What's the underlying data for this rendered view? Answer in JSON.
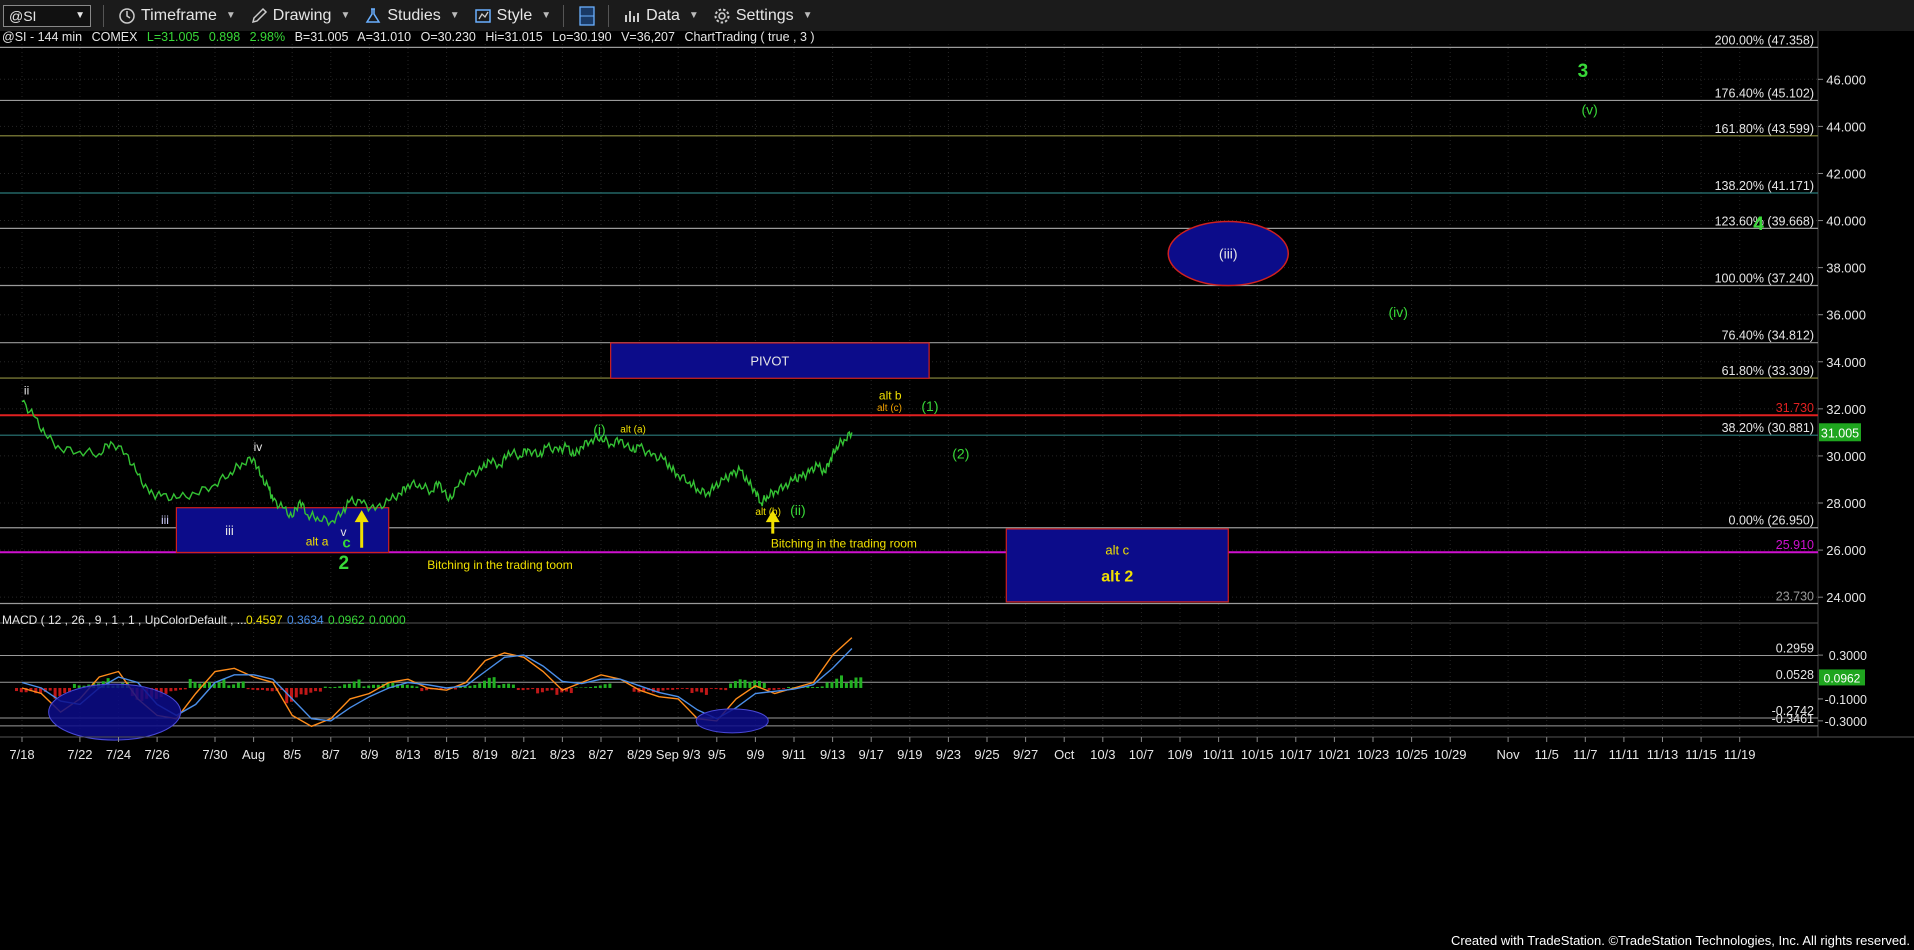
{
  "toolbar": {
    "symbol": "@SI",
    "timeframe": "Timeframe",
    "drawing": "Drawing",
    "studies": "Studies",
    "style": "Style",
    "data": "Data",
    "settings": "Settings"
  },
  "header_line": {
    "symbol": "@SI - 144 min",
    "exchange": "COMEX",
    "last": "L=31.005",
    "change": "0.898",
    "pct": "2.98%",
    "bid": "B=31.005",
    "ask": "A=31.010",
    "open": "O=30.230",
    "high": "Hi=31.015",
    "low": "Lo=30.190",
    "volume": "V=36,207",
    "study": "ChartTrading ( true , 3 )"
  },
  "footer": "Created with TradeStation. ©TradeStation Technologies, Inc. All rights reserved.",
  "colors": {
    "price": "#34c234",
    "fib_line": "#9a9a9a",
    "red_line": "#e02020",
    "magenta_line": "#d010d0",
    "box_fill": "#0c0c8a",
    "box_border": "#d02020",
    "label_yellow": "#f0e000",
    "label_green": "#38d838",
    "macd_blue": "#4a8ee8",
    "macd_orange": "#ff8c1a",
    "hist_green": "#22b022",
    "hist_red": "#c01818"
  },
  "chart_data": {
    "type": "line",
    "title": "@SI - 144 min",
    "xlabel": "",
    "ylabel": "",
    "ylim": [
      23.2,
      47.5
    ],
    "x_ticks": [
      "7/18",
      "7/22",
      "7/24",
      "7/26",
      "7/30",
      "Aug",
      "8/5",
      "8/7",
      "8/9",
      "8/13",
      "8/15",
      "8/19",
      "8/21",
      "8/23",
      "8/27",
      "8/29",
      "Sep 9/3",
      "9/5",
      "9/9",
      "9/11",
      "9/13",
      "9/17",
      "9/19",
      "9/23",
      "9/25",
      "9/27",
      "Oct",
      "10/3",
      "10/7",
      "10/9",
      "10/11",
      "10/15",
      "10/17",
      "10/21",
      "10/23",
      "10/25",
      "10/29",
      "Nov",
      "11/5",
      "11/7",
      "11/11",
      "11/13",
      "11/15",
      "11/19"
    ],
    "x_tick_index": [
      0,
      3,
      5,
      7,
      10,
      12,
      14,
      16,
      18,
      20,
      22,
      24,
      26,
      28,
      30,
      32,
      34,
      36,
      38,
      40,
      42,
      44,
      46,
      48,
      50,
      52,
      54,
      56,
      58,
      60,
      62,
      64,
      66,
      68,
      70,
      72,
      74,
      77,
      79,
      81,
      83,
      85,
      87,
      89
    ],
    "y_ticks": [
      24.0,
      26.0,
      28.0,
      30.0,
      32.0,
      34.0,
      36.0,
      38.0,
      40.0,
      42.0,
      44.0,
      46.0
    ],
    "series": [
      {
        "values": [
          [
            0,
            32.3
          ],
          [
            0.6,
            31.7
          ],
          [
            1.2,
            30.9
          ],
          [
            2,
            30.3
          ],
          [
            3,
            30.2
          ],
          [
            4,
            30.1
          ],
          [
            4.6,
            30.6
          ],
          [
            5.4,
            30.1
          ],
          [
            6,
            29.2
          ],
          [
            6.6,
            28.4
          ],
          [
            7.2,
            28.3
          ],
          [
            8,
            28.2
          ],
          [
            9,
            28.4
          ],
          [
            10,
            28.8
          ],
          [
            10.8,
            29.3
          ],
          [
            11.4,
            29.7
          ],
          [
            12,
            29.9
          ],
          [
            12.4,
            29.1
          ],
          [
            12.8,
            28.6
          ],
          [
            13,
            28.1
          ],
          [
            13.5,
            27.8
          ],
          [
            14,
            27.4
          ],
          [
            14.4,
            28.1
          ],
          [
            14.8,
            27.5
          ],
          [
            15.3,
            27.4
          ],
          [
            16,
            27.2
          ],
          [
            16.6,
            27.6
          ],
          [
            17,
            28.1
          ],
          [
            17.6,
            28.0
          ],
          [
            18.3,
            27.7
          ],
          [
            19,
            28.1
          ],
          [
            19.6,
            28.4
          ],
          [
            20,
            28.8
          ],
          [
            20.6,
            28.8
          ],
          [
            21.2,
            28.5
          ],
          [
            21.6,
            28.9
          ],
          [
            22.1,
            28.1
          ],
          [
            22.6,
            28.7
          ],
          [
            23.2,
            29.2
          ],
          [
            23.8,
            29.4
          ],
          [
            24.2,
            29.8
          ],
          [
            24.8,
            29.6
          ],
          [
            25.2,
            30.2
          ],
          [
            25.8,
            30.0
          ],
          [
            26.2,
            30.3
          ],
          [
            26.8,
            30.0
          ],
          [
            27.2,
            30.4
          ],
          [
            27.8,
            30.2
          ],
          [
            28.2,
            30.4
          ],
          [
            28.6,
            30.0
          ],
          [
            29,
            30.4
          ],
          [
            29.5,
            30.7
          ],
          [
            30,
            30.8
          ],
          [
            30.5,
            30.5
          ],
          [
            31,
            30.7
          ],
          [
            31.6,
            30.2
          ],
          [
            32,
            30.4
          ],
          [
            32.6,
            30.0
          ],
          [
            33.2,
            29.9
          ],
          [
            33.6,
            29.5
          ],
          [
            34,
            29.2
          ],
          [
            34.6,
            28.9
          ],
          [
            35,
            28.6
          ],
          [
            35.5,
            28.4
          ],
          [
            35.9,
            28.7
          ],
          [
            36.4,
            29.0
          ],
          [
            36.8,
            29.2
          ],
          [
            37.2,
            29.4
          ],
          [
            37.6,
            28.9
          ],
          [
            38,
            28.5
          ],
          [
            38.3,
            28.0
          ],
          [
            38.6,
            28.3
          ],
          [
            39,
            28.5
          ],
          [
            39.5,
            28.7
          ],
          [
            40,
            29.0
          ],
          [
            40.4,
            29.1
          ],
          [
            40.8,
            29.3
          ],
          [
            41.2,
            29.6
          ],
          [
            41.6,
            29.3
          ],
          [
            41.9,
            29.9
          ],
          [
            42.2,
            30.4
          ],
          [
            42.6,
            30.7
          ],
          [
            43,
            31.0
          ]
        ]
      }
    ],
    "horizontal_levels": [
      {
        "label": "200.00% (47.358)",
        "value": 47.358,
        "color": "#9a9a9a"
      },
      {
        "label": "176.40% (45.102)",
        "value": 45.102,
        "color": "#9a9a9a"
      },
      {
        "label": "161.80% (43.599)",
        "value": 43.599,
        "color": "#8f8f40"
      },
      {
        "label": "138.20% (41.171)",
        "value": 41.171,
        "color": "#2a7a7a"
      },
      {
        "label": "123.60% (39.668)",
        "value": 39.668,
        "color": "#9a9a9a"
      },
      {
        "label": "100.00% (37.240)",
        "value": 37.24,
        "color": "#9a9a9a"
      },
      {
        "label": "76.40% (34.812)",
        "value": 34.812,
        "color": "#9a9a9a"
      },
      {
        "label": "61.80% (33.309)",
        "value": 33.309,
        "color": "#8f8f40"
      },
      {
        "label": "38.20% (30.881)",
        "value": 30.881,
        "color": "#2a7a7a"
      },
      {
        "label": "0.00% (26.950)",
        "value": 26.95,
        "color": "#9a9a9a"
      },
      {
        "label": "31.730",
        "value": 31.73,
        "color": "#e02020"
      },
      {
        "label": "25.910",
        "value": 25.91,
        "color": "#d010d0"
      },
      {
        "label": "23.730",
        "value": 23.73,
        "color": "#9a9a9a"
      }
    ],
    "last_price": {
      "label": "31.005",
      "value": 31.005
    },
    "boxes": [
      {
        "label": "iii",
        "x0": 8,
        "x1": 19,
        "y0": 25.9,
        "y1": 27.8
      },
      {
        "label": "PIVOT",
        "x0": 30.5,
        "x1": 47,
        "y0": 33.3,
        "y1": 34.8
      },
      {
        "label": "alt c",
        "label2": "alt 2",
        "x0": 51,
        "x1": 62.5,
        "y0": 23.8,
        "y1": 26.9
      }
    ],
    "ellipses": [
      {
        "label": "(iii)",
        "x": 62.5,
        "y": 38.6
      }
    ],
    "annotations": [
      {
        "text": "ii",
        "x": 0.1,
        "y": 32.6,
        "color": "#e6e6e6"
      },
      {
        "text": "iv",
        "x": 12,
        "y": 30.2,
        "color": "#e6e6e6"
      },
      {
        "text": "iii",
        "x": 7.2,
        "y": 27.1,
        "color": "#cfcfff"
      },
      {
        "text": "alt a",
        "x": 14.7,
        "y": 26.2,
        "color": "#f0e000"
      },
      {
        "text": "v",
        "x": 16.5,
        "y": 26.6,
        "color": "#e6e6e6"
      },
      {
        "text": "c",
        "x": 16.6,
        "y": 26.1,
        "color": "#38d838"
      },
      {
        "text": "2",
        "x": 16.4,
        "y": 25.2,
        "color": "#38d838"
      },
      {
        "text": "Bitching in the trading toom",
        "x": 21,
        "y": 25.2,
        "color": "#f0e000"
      },
      {
        "text": "(i)",
        "x": 29.6,
        "y": 30.9,
        "color": "#38d838"
      },
      {
        "text": "alt (a)",
        "x": 31,
        "y": 31.0,
        "color": "#f0e000"
      },
      {
        "text": "alt b",
        "x": 44.4,
        "y": 32.4,
        "color": "#f0e000"
      },
      {
        "text": "alt (c)",
        "x": 44.3,
        "y": 31.9,
        "color": "#f0a000"
      },
      {
        "text": "(1)",
        "x": 46.6,
        "y": 31.9,
        "color": "#38d838"
      },
      {
        "text": "(2)",
        "x": 48.2,
        "y": 29.9,
        "color": "#38d838"
      },
      {
        "text": "alt (b)",
        "x": 38,
        "y": 27.5,
        "color": "#f0e000"
      },
      {
        "text": "(ii)",
        "x": 39.8,
        "y": 27.5,
        "color": "#38d838"
      },
      {
        "text": "Bitching in the trading room",
        "x": 38.8,
        "y": 26.1,
        "color": "#f0e000"
      },
      {
        "text": "(iv)",
        "x": 70.8,
        "y": 35.9,
        "color": "#38d838"
      },
      {
        "text": "4",
        "x": 89.7,
        "y": 39.6,
        "color": "#38d838"
      },
      {
        "text": "3",
        "x": 80.6,
        "y": 46.1,
        "color": "#38d838"
      },
      {
        "text": "(v)",
        "x": 80.8,
        "y": 44.5,
        "color": "#38d838"
      }
    ],
    "arrows": [
      {
        "x": 17.6,
        "y_top": 27.7,
        "y_bottom": 26.1
      },
      {
        "x": 38.9,
        "y_top": 27.7,
        "y_bottom": 26.7
      }
    ],
    "macd": {
      "title": "MACD ( 12 , 26 , 9 , 1 , 1 , UpColorDefault , ...",
      "values_text": [
        "0.4597",
        "0.3634",
        "0.0962",
        "0.0000"
      ],
      "ylim": [
        -0.42,
        0.52
      ],
      "y_ticks": [
        0.3,
        -0.1,
        -0.3
      ],
      "levels": [
        {
          "label": "0.2959",
          "value": 0.2959
        },
        {
          "label": "0.0528",
          "value": 0.0528
        },
        {
          "label": "-0.2742",
          "value": -0.2742
        },
        {
          "label": "-0.3461",
          "value": -0.3461
        }
      ],
      "last_label": {
        "label": "0.0962",
        "value": 0.0962
      },
      "macd_line": [
        [
          0,
          0.0
        ],
        [
          1,
          -0.05
        ],
        [
          2,
          -0.22
        ],
        [
          3,
          -0.1
        ],
        [
          4,
          0.1
        ],
        [
          5,
          0.15
        ],
        [
          6,
          -0.1
        ],
        [
          7,
          -0.25
        ],
        [
          8,
          -0.28
        ],
        [
          9,
          -0.05
        ],
        [
          10,
          0.15
        ],
        [
          11,
          0.18
        ],
        [
          12,
          0.1
        ],
        [
          13,
          0.05
        ],
        [
          14,
          -0.25
        ],
        [
          15,
          -0.35
        ],
        [
          16,
          -0.28
        ],
        [
          17,
          -0.1
        ],
        [
          18,
          -0.05
        ],
        [
          19,
          0.05
        ],
        [
          20,
          0.08
        ],
        [
          21,
          0.0
        ],
        [
          22,
          -0.02
        ],
        [
          23,
          0.05
        ],
        [
          24,
          0.25
        ],
        [
          25,
          0.32
        ],
        [
          26,
          0.28
        ],
        [
          27,
          0.15
        ],
        [
          28,
          -0.02
        ],
        [
          29,
          0.05
        ],
        [
          30,
          0.12
        ],
        [
          31,
          0.08
        ],
        [
          32,
          -0.02
        ],
        [
          33,
          -0.08
        ],
        [
          34,
          -0.1
        ],
        [
          35,
          -0.28
        ],
        [
          36,
          -0.3
        ],
        [
          37,
          -0.1
        ],
        [
          38,
          0.02
        ],
        [
          39,
          -0.05
        ],
        [
          40,
          0.0
        ],
        [
          41,
          0.05
        ],
        [
          42,
          0.3
        ],
        [
          43,
          0.46
        ]
      ],
      "signal_line": [
        [
          0,
          0.05
        ],
        [
          1,
          0.0
        ],
        [
          2,
          -0.12
        ],
        [
          3,
          -0.15
        ],
        [
          4,
          0.0
        ],
        [
          5,
          0.1
        ],
        [
          6,
          0.05
        ],
        [
          7,
          -0.15
        ],
        [
          8,
          -0.25
        ],
        [
          9,
          -0.15
        ],
        [
          10,
          0.05
        ],
        [
          11,
          0.12
        ],
        [
          12,
          0.12
        ],
        [
          13,
          0.08
        ],
        [
          14,
          -0.1
        ],
        [
          15,
          -0.28
        ],
        [
          16,
          -0.3
        ],
        [
          17,
          -0.18
        ],
        [
          18,
          -0.08
        ],
        [
          19,
          0.0
        ],
        [
          20,
          0.05
        ],
        [
          21,
          0.03
        ],
        [
          22,
          0.0
        ],
        [
          23,
          0.02
        ],
        [
          24,
          0.15
        ],
        [
          25,
          0.28
        ],
        [
          26,
          0.3
        ],
        [
          27,
          0.2
        ],
        [
          28,
          0.06
        ],
        [
          29,
          0.04
        ],
        [
          30,
          0.08
        ],
        [
          31,
          0.08
        ],
        [
          32,
          0.02
        ],
        [
          33,
          -0.04
        ],
        [
          34,
          -0.08
        ],
        [
          35,
          -0.2
        ],
        [
          36,
          -0.28
        ],
        [
          37,
          -0.18
        ],
        [
          38,
          -0.05
        ],
        [
          39,
          -0.03
        ],
        [
          40,
          -0.01
        ],
        [
          41,
          0.03
        ],
        [
          42,
          0.18
        ],
        [
          43,
          0.36
        ]
      ],
      "histogram": [
        [
          0,
          -0.04
        ],
        [
          1,
          -0.05
        ],
        [
          2,
          -0.1
        ],
        [
          3,
          0.05
        ],
        [
          4,
          0.1
        ],
        [
          5,
          0.05
        ],
        [
          6,
          -0.12
        ],
        [
          7,
          -0.1
        ],
        [
          8,
          -0.03
        ],
        [
          9,
          0.1
        ],
        [
          10,
          0.1
        ],
        [
          11,
          0.06
        ],
        [
          12,
          -0.02
        ],
        [
          13,
          -0.03
        ],
        [
          14,
          -0.14
        ],
        [
          15,
          -0.07
        ],
        [
          16,
          0.02
        ],
        [
          17,
          0.08
        ],
        [
          18,
          0.03
        ],
        [
          19,
          0.05
        ],
        [
          20,
          0.03
        ],
        [
          21,
          -0.03
        ],
        [
          22,
          -0.02
        ],
        [
          23,
          0.03
        ],
        [
          24,
          0.1
        ],
        [
          25,
          0.04
        ],
        [
          26,
          -0.02
        ],
        [
          27,
          -0.05
        ],
        [
          28,
          -0.08
        ],
        [
          29,
          0.01
        ],
        [
          30,
          0.04
        ],
        [
          31,
          0.0
        ],
        [
          32,
          -0.04
        ],
        [
          33,
          -0.04
        ],
        [
          34,
          -0.02
        ],
        [
          35,
          -0.08
        ],
        [
          36,
          -0.02
        ],
        [
          37,
          0.08
        ],
        [
          38,
          0.07
        ],
        [
          39,
          -0.02
        ],
        [
          40,
          0.01
        ],
        [
          41,
          0.02
        ],
        [
          42,
          0.12
        ],
        [
          43,
          0.1
        ]
      ],
      "ellipses": [
        {
          "x": 4.8,
          "y": -0.22
        },
        {
          "x": 36.8,
          "y": -0.3
        }
      ]
    }
  }
}
